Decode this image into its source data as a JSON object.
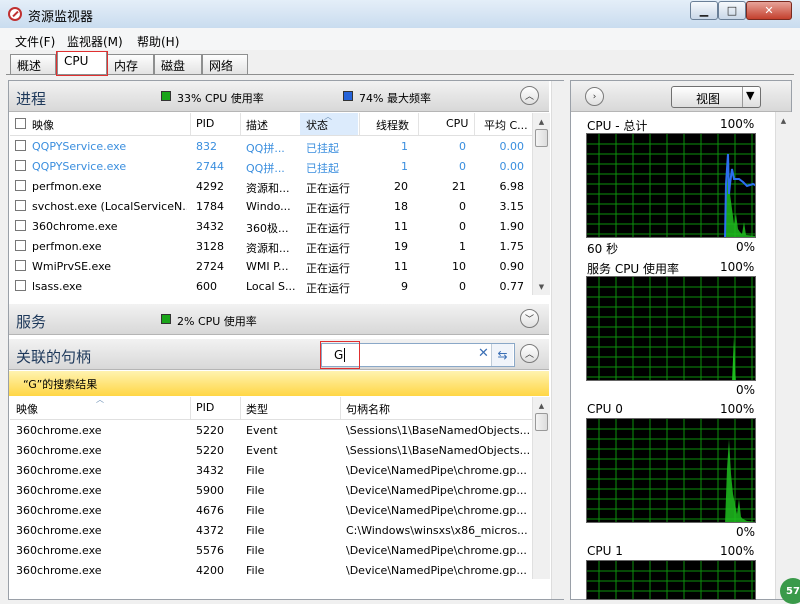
{
  "window": {
    "title": "资源监视器",
    "min_glyph": "▁",
    "max_glyph": "□",
    "close_glyph": "✕"
  },
  "menu": [
    "文件(F)",
    "监视器(M)",
    "帮助(H)"
  ],
  "tabs": [
    "概述",
    "CPU",
    "内存",
    "磁盘",
    "网络"
  ],
  "active_tab": "CPU",
  "processes": {
    "title": "进程",
    "legend1": "33% CPU 使用率",
    "legend2": "74% 最大频率",
    "legend1_color": "#1aa51a",
    "legend2_color": "#2563d9",
    "columns": [
      "映像",
      "PID",
      "描述",
      "状态",
      "线程数",
      "CPU",
      "平均 C..."
    ],
    "rows": [
      {
        "name": "QQPYService.exe",
        "pid": "832",
        "desc": "QQ拼...",
        "status": "已挂起",
        "threads": "1",
        "cpu": "0",
        "avg": "0.00",
        "suspended": true
      },
      {
        "name": "QQPYService.exe",
        "pid": "2744",
        "desc": "QQ拼...",
        "status": "已挂起",
        "threads": "1",
        "cpu": "0",
        "avg": "0.00",
        "suspended": true
      },
      {
        "name": "perfmon.exe",
        "pid": "4292",
        "desc": "资源和...",
        "status": "正在运行",
        "threads": "20",
        "cpu": "21",
        "avg": "6.98",
        "suspended": false
      },
      {
        "name": "svchost.exe (LocalServiceN...",
        "pid": "1784",
        "desc": "Windo...",
        "status": "正在运行",
        "threads": "18",
        "cpu": "0",
        "avg": "3.15",
        "suspended": false
      },
      {
        "name": "360chrome.exe",
        "pid": "3432",
        "desc": "360极...",
        "status": "正在运行",
        "threads": "11",
        "cpu": "0",
        "avg": "1.90",
        "suspended": false
      },
      {
        "name": "perfmon.exe",
        "pid": "3128",
        "desc": "资源和...",
        "status": "正在运行",
        "threads": "19",
        "cpu": "1",
        "avg": "1.75",
        "suspended": false
      },
      {
        "name": "WmiPrvSE.exe",
        "pid": "2724",
        "desc": "WMI P...",
        "status": "正在运行",
        "threads": "11",
        "cpu": "10",
        "avg": "0.90",
        "suspended": false
      },
      {
        "name": "lsass.exe",
        "pid": "600",
        "desc": "Local S...",
        "status": "正在运行",
        "threads": "9",
        "cpu": "0",
        "avg": "0.77",
        "suspended": false
      }
    ]
  },
  "services": {
    "title": "服务",
    "legend": "2% CPU 使用率"
  },
  "handles": {
    "title": "关联的句柄",
    "search_value": "G",
    "results_label": "“G”的搜索结果",
    "columns": [
      "映像",
      "PID",
      "类型",
      "句柄名称"
    ],
    "rows": [
      {
        "image": "360chrome.exe",
        "pid": "5220",
        "type": "Event",
        "name": "\\Sessions\\1\\BaseNamedObjects..."
      },
      {
        "image": "360chrome.exe",
        "pid": "5220",
        "type": "Event",
        "name": "\\Sessions\\1\\BaseNamedObjects..."
      },
      {
        "image": "360chrome.exe",
        "pid": "3432",
        "type": "File",
        "name": "\\Device\\NamedPipe\\chrome.gp..."
      },
      {
        "image": "360chrome.exe",
        "pid": "5900",
        "type": "File",
        "name": "\\Device\\NamedPipe\\chrome.gp..."
      },
      {
        "image": "360chrome.exe",
        "pid": "4676",
        "type": "File",
        "name": "\\Device\\NamedPipe\\chrome.gp..."
      },
      {
        "image": "360chrome.exe",
        "pid": "4372",
        "type": "File",
        "name": "C:\\Windows\\winsxs\\x86_micros..."
      },
      {
        "image": "360chrome.exe",
        "pid": "5576",
        "type": "File",
        "name": "\\Device\\NamedPipe\\chrome.gp..."
      },
      {
        "image": "360chrome.exe",
        "pid": "4200",
        "type": "File",
        "name": "\\Device\\NamedPipe\\chrome.gp..."
      }
    ]
  },
  "right": {
    "view_label": "视图",
    "graphs": [
      {
        "title": "CPU - 总计",
        "max": "100%",
        "time": "60 秒",
        "min": "0%"
      },
      {
        "title": "服务 CPU 使用率",
        "max": "100%",
        "min": "0%"
      },
      {
        "title": "CPU 0",
        "max": "100%",
        "min": "0%"
      },
      {
        "title": "CPU 1",
        "max": "100%"
      }
    ]
  },
  "badge": "57",
  "icons": {
    "collapse": "chevron-up-icon",
    "expand": "chevron-down-icon",
    "clear": "clear-icon",
    "search_go": "refresh-icon",
    "panel_toggle": "chevron-right-icon",
    "dropdown": "caret-down-icon"
  }
}
